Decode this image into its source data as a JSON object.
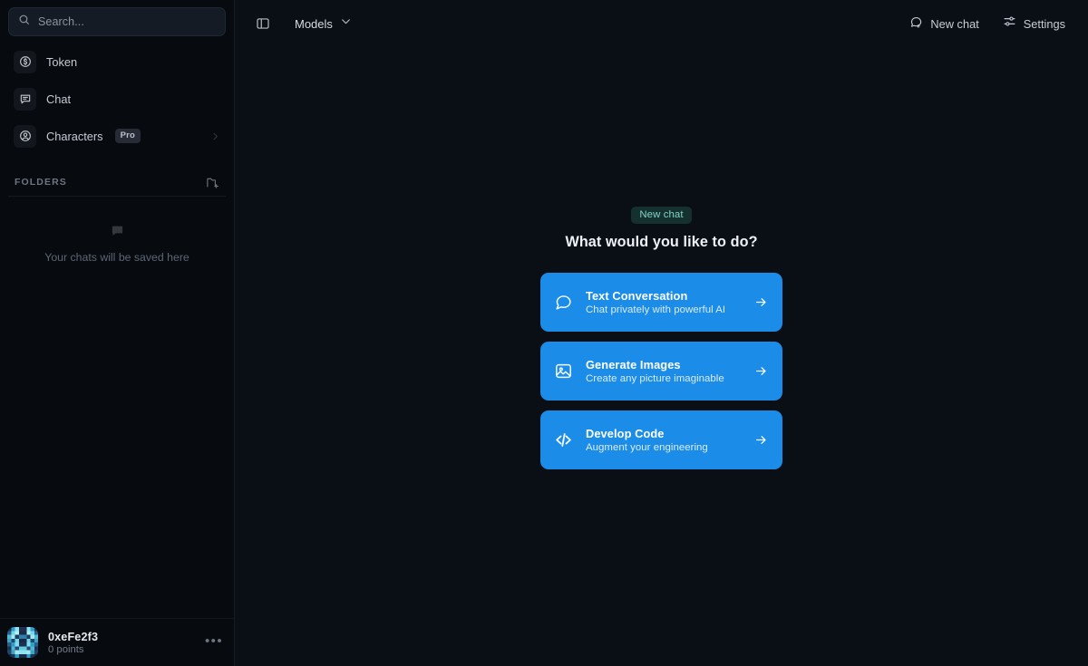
{
  "sidebar": {
    "search": {
      "placeholder": "Search...",
      "icon": "search-icon"
    },
    "nav_items": [
      {
        "label": "Token",
        "icon": "dollar-circle-icon",
        "badge": null
      },
      {
        "label": "Chat",
        "icon": "chat-bubble-icon",
        "badge": null
      },
      {
        "label": "Characters",
        "icon": "user-circle-icon",
        "badge": "Pro"
      }
    ],
    "folders": {
      "title": "FOLDERS",
      "add_icon": "folder-plus-icon",
      "empty_icon": "message-square-icon",
      "empty_text": "Your chats will be saved here"
    },
    "user": {
      "name": "0xeFe2f3",
      "points": "0 points",
      "more_icon": "ellipsis-icon",
      "avatar_icon": "identicon-avatar"
    }
  },
  "header": {
    "panel_toggle_icon": "sidebar-panel-icon",
    "models_label": "Models",
    "models_chevron_icon": "chevron-down-icon",
    "new_chat_label": "New chat",
    "new_chat_icon": "message-plus-icon",
    "settings_label": "Settings",
    "settings_icon": "sliders-icon"
  },
  "main": {
    "badge": "New chat",
    "headline": "What would you like to do?",
    "cards": [
      {
        "title": "Text Conversation",
        "subtitle": "Chat privately with powerful AI",
        "icon": "chat-bubble-icon",
        "arrow_icon": "arrow-right-icon"
      },
      {
        "title": "Generate Images",
        "subtitle": "Create any picture imaginable",
        "icon": "image-icon",
        "arrow_icon": "arrow-right-icon"
      },
      {
        "title": "Develop Code",
        "subtitle": "Augment your engineering",
        "icon": "code-icon",
        "arrow_icon": "arrow-right-icon"
      }
    ]
  },
  "colors": {
    "accent_blue": "#1b8ce8",
    "badge_teal_text": "#7fd3c4",
    "badge_teal_bg": "#15312f",
    "app_bg": "#070a0f",
    "main_bg": "#0a0e15"
  }
}
